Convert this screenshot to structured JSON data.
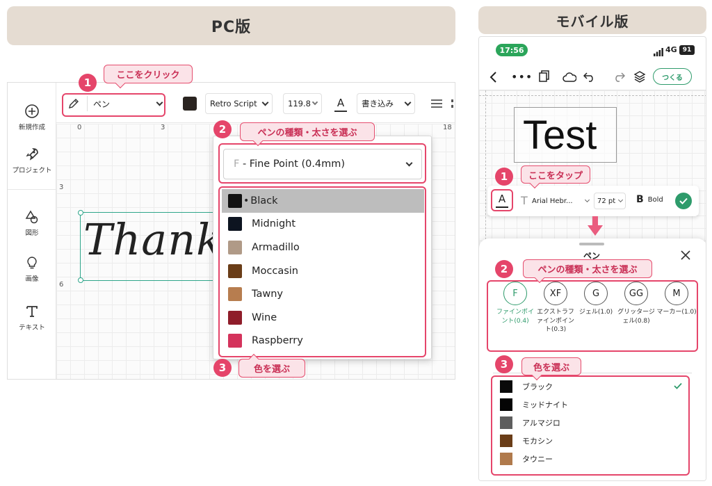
{
  "headers": {
    "pc": "PC版",
    "mobile": "モバイル版"
  },
  "pc": {
    "sidebar": [
      {
        "label": "新規作成",
        "icon": "plus-circle-icon"
      },
      {
        "label": "プロジェクト",
        "icon": "rocket-icon"
      },
      {
        "label": "図形",
        "icon": "shapes-icon"
      },
      {
        "label": "画像",
        "icon": "lightbulb-icon"
      },
      {
        "label": "テキスト",
        "icon": "text-t-icon"
      }
    ],
    "toolbar": {
      "pen_label": "ペン",
      "font": "Retro Script",
      "size": "119.8",
      "mode": "書き込み"
    },
    "ruler": {
      "top": [
        "0",
        "3",
        "18"
      ],
      "left": [
        "3",
        "6"
      ]
    },
    "canvas_text": "ThankS",
    "dropdown": {
      "pen_type_prefix": "F",
      "pen_type": " - Fine Point (0.4mm)",
      "colors": [
        {
          "name": "Black",
          "hex": "#111111",
          "selected": true
        },
        {
          "name": "Midnight",
          "hex": "#0d1420"
        },
        {
          "name": "Armadillo",
          "hex": "#b09a87"
        },
        {
          "name": "Moccasin",
          "hex": "#6a3d18"
        },
        {
          "name": "Tawny",
          "hex": "#b77d4f"
        },
        {
          "name": "Wine",
          "hex": "#8f1d2a"
        },
        {
          "name": "Raspberry",
          "hex": "#d4335c"
        }
      ]
    },
    "callouts": [
      {
        "num": "1",
        "text": "ここをクリック"
      },
      {
        "num": "2",
        "text": "ペンの種類・太さを選ぶ"
      },
      {
        "num": "3",
        "text": "色を選ぶ"
      }
    ]
  },
  "mobile": {
    "status": {
      "time": "17:56",
      "network": "4G",
      "battery": "91"
    },
    "nav": {
      "make_button": "つくる"
    },
    "canvas_text": "Test",
    "toolbar": {
      "font": "Arial Hebr...",
      "size": "72 pt",
      "bold_glyph": "B",
      "bold": "Bold"
    },
    "sheet_title": "ペン",
    "pens": [
      {
        "code": "F",
        "label": "ファインポイント(0.4)",
        "active": true
      },
      {
        "code": "XF",
        "label": "エクストラファインポイント(0.3)"
      },
      {
        "code": "G",
        "label": "ジェル(1.0)"
      },
      {
        "code": "GG",
        "label": "グリッタージェル(0.8)"
      },
      {
        "code": "M",
        "label": "マーカー(1.0)"
      }
    ],
    "colors": [
      {
        "name": "ブラック",
        "hex": "#0a0a0a",
        "selected": true
      },
      {
        "name": "ミッドナイト",
        "hex": "#050505"
      },
      {
        "name": "アルマジロ",
        "hex": "#5e5e5e"
      },
      {
        "name": "モカシン",
        "hex": "#6a3d18"
      },
      {
        "name": "タウニー",
        "hex": "#b07a4c"
      }
    ],
    "callouts": [
      {
        "num": "1",
        "text": "ここをタップ"
      },
      {
        "num": "2",
        "text": "ペンの種類・太さを選ぶ"
      },
      {
        "num": "3",
        "text": "色を選ぶ"
      }
    ],
    "accent": "#2e9b6b"
  },
  "colors": {
    "callout_border": "#e54d6e",
    "callout_fill": "#fbe3e8",
    "callout_text": "#c92f55",
    "banner": "#e5dcd2",
    "selection_teal": "#2ea58a"
  }
}
